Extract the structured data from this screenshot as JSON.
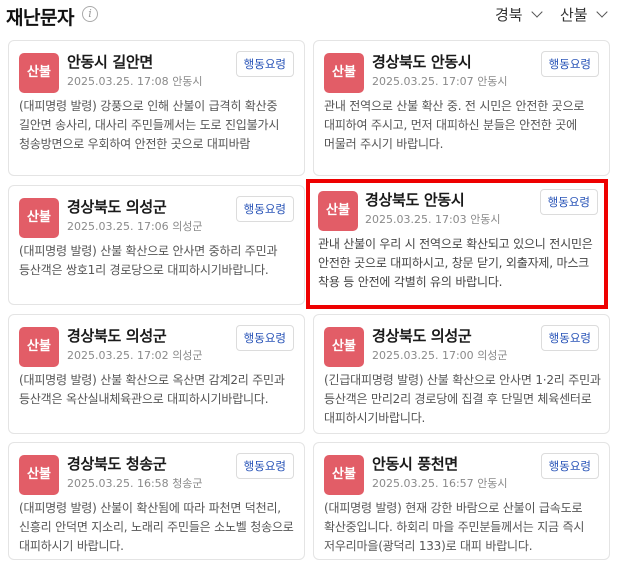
{
  "header": {
    "title": "재난문자",
    "info_icon": "info-icon",
    "filter_region": "경북",
    "filter_type": "산불"
  },
  "cards": [
    {
      "badge": "산불",
      "title": "안동시 길안면",
      "date": "2025.03.25. 17:08",
      "source": "안동시",
      "action": "행동요령",
      "body": "(대피명령 발령) 강풍으로 인해 산불이 급격히 확산중 길안면 송사리, 대사리 주민들께서는 도로 진입불가시 청송방면으로 우회하여 안전한 곳으로 대피바람"
    },
    {
      "badge": "산불",
      "title": "경상북도 안동시",
      "date": "2025.03.25. 17:07",
      "source": "안동시",
      "action": "행동요령",
      "body": "관내 전역으로 산불 확산 중. 전 시민은 안전한 곳으로 대피하여 주시고, 먼저 대피하신 분들은 안전한 곳에 머물러 주시기 바랍니다."
    },
    {
      "badge": "산불",
      "title": "경상북도 의성군",
      "date": "2025.03.25. 17:06",
      "source": "의성군",
      "action": "행동요령",
      "body": "(대피명령 발령) 산불 확산으로 안사면 중하리 주민과 등산객은 쌍호1리 경로당으로 대피하시기바랍니다."
    },
    {
      "badge": "산불",
      "title": "경상북도 안동시",
      "date": "2025.03.25. 17:03",
      "source": "안동시",
      "action": "행동요령",
      "body": "관내 산불이 우리 시 전역으로 확산되고 있으니 전시민은 안전한 곳으로 대피하시고, 창문 닫기, 외출자제, 마스크 착용 등 안전에 각별히 유의 바랍니다."
    },
    {
      "badge": "산불",
      "title": "경상북도 의성군",
      "date": "2025.03.25. 17:02",
      "source": "의성군",
      "action": "행동요령",
      "body": "(대피명령 발령) 산불 확산으로 옥산면 감계2리 주민과 등산객은 옥산실내체육관으로 대피하시기바랍니다."
    },
    {
      "badge": "산불",
      "title": "경상북도 의성군",
      "date": "2025.03.25. 17:00",
      "source": "의성군",
      "action": "행동요령",
      "body": "(긴급대피명령 발령) 산불 확산으로 안사면 1·2리 주민과 등산객은 만리2리 경로당에 집결 후 단밀면 체육센터로 대피하시기바랍니다."
    },
    {
      "badge": "산불",
      "title": "경상북도 청송군",
      "date": "2025.03.25. 16:58",
      "source": "청송군",
      "action": "행동요령",
      "body": "(대피명령 발령) 산불이 확산됨에 따라 파천면 덕천리, 신흥리 안덕면 지소리, 노래리 주민들은 소노벨 청송으로 대피하시기 바랍니다."
    },
    {
      "badge": "산불",
      "title": "안동시 풍천면",
      "date": "2025.03.25. 16:57",
      "source": "안동시",
      "action": "행동요령",
      "body": "(대피명령 발령) 현재 강한 바람으로 산불이 급속도로 확산중입니다. 하회리 마을 주민분들께서는 지금 즉시 저우리마을(광덕리 133)로 대피 바랍니다."
    }
  ],
  "colors": {
    "badge": "#e25d67",
    "action_text": "#2a55b8",
    "highlight_border": "#ee0000"
  }
}
